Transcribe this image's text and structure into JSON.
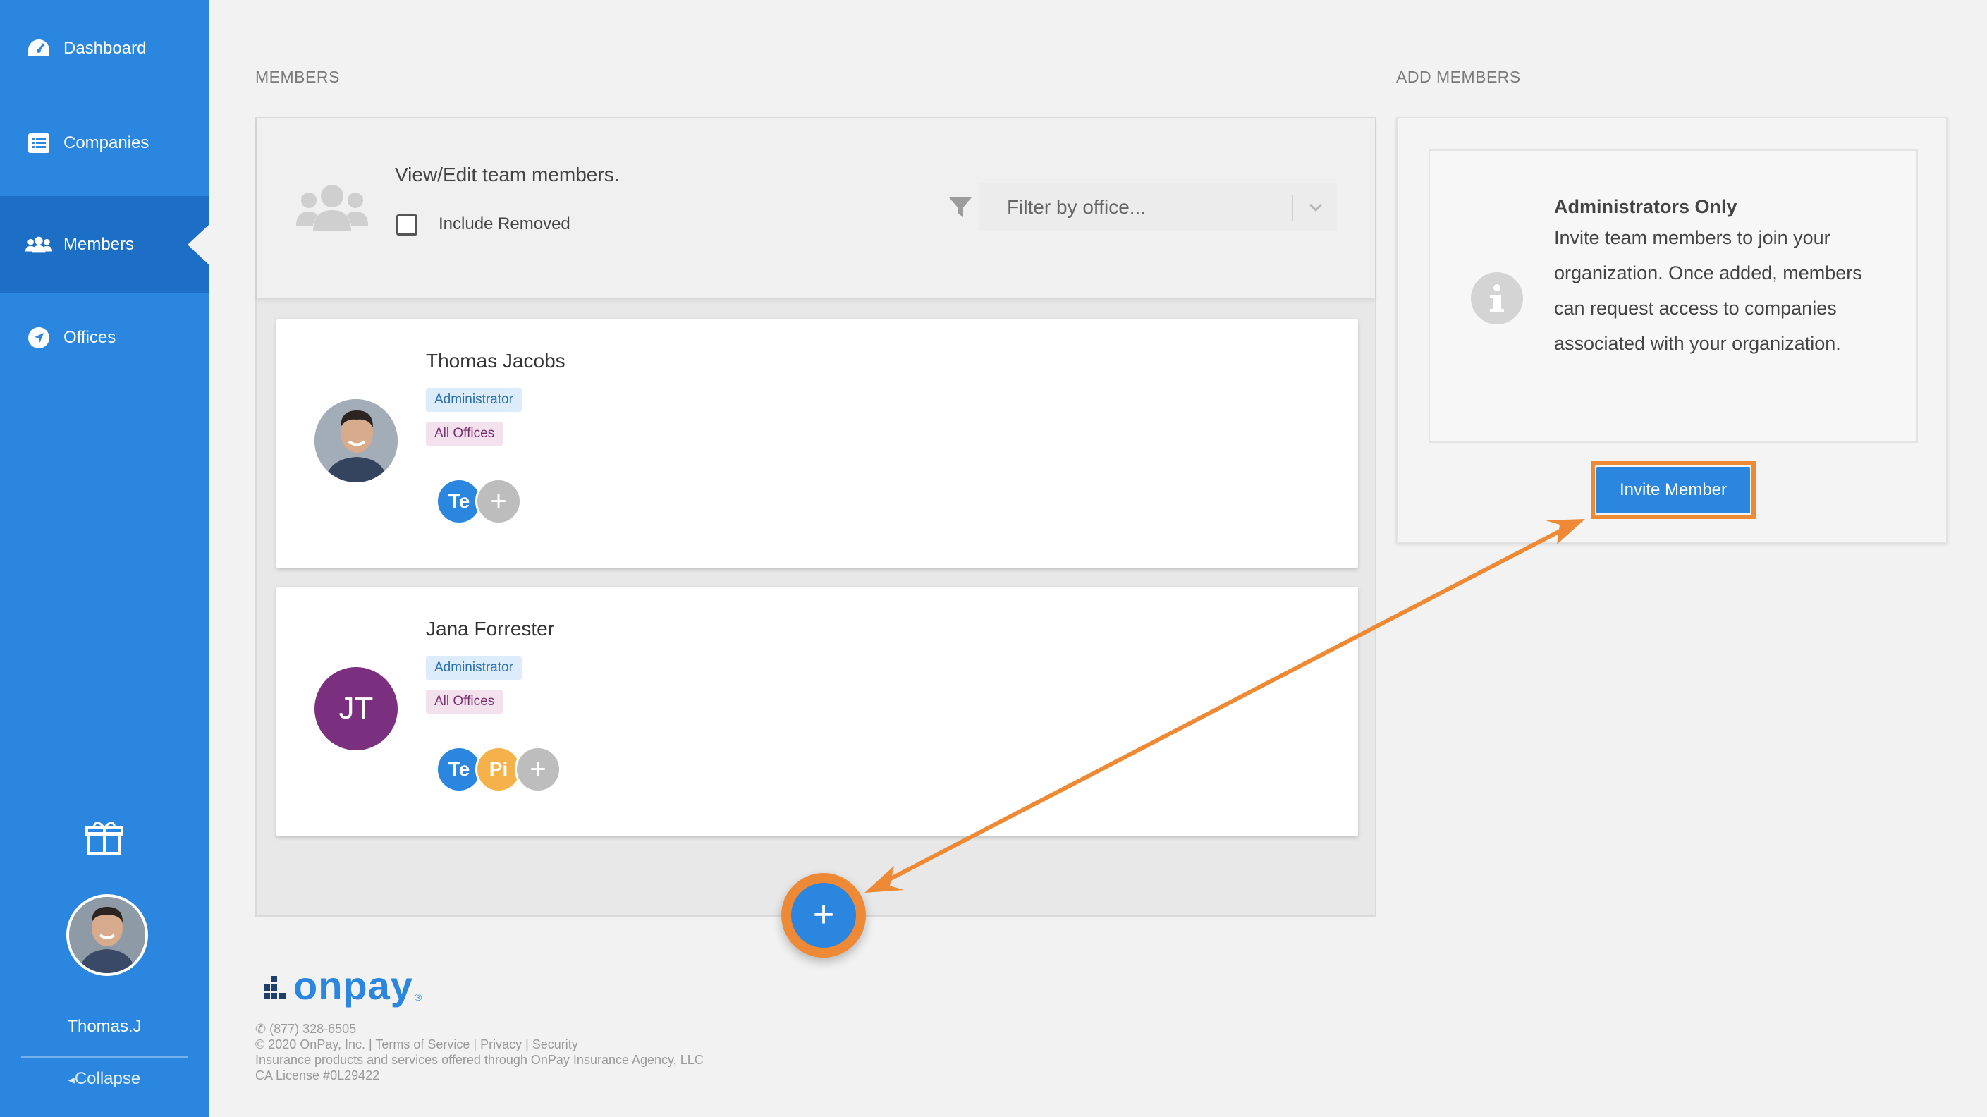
{
  "sidebar": {
    "items": [
      {
        "label": "Dashboard",
        "icon": "dashboard-icon"
      },
      {
        "label": "Companies",
        "icon": "list-icon"
      },
      {
        "label": "Members",
        "icon": "users-icon"
      },
      {
        "label": "Offices",
        "icon": "location-arrow-icon"
      }
    ],
    "active": "Members",
    "user_name": "Thomas.J",
    "collapse_label": "Collapse"
  },
  "members": {
    "heading": "MEMBERS",
    "panel_title": "View/Edit team members.",
    "include_removed_label": "Include Removed",
    "filter_placeholder": "Filter by office...",
    "list": [
      {
        "name": "Thomas Jacobs",
        "role": "Administrator",
        "offices": "All Offices",
        "avatar": "photo",
        "companies": [
          "Te"
        ]
      },
      {
        "name": "Jana Forrester",
        "role": "Administrator",
        "offices": "All Offices",
        "initials": "JT",
        "avatar_color": "#7b2f7f",
        "companies": [
          "Te",
          "Pi"
        ]
      }
    ],
    "fab_label": "+"
  },
  "add_members": {
    "heading": "ADD MEMBERS",
    "info_title": "Administrators Only",
    "info_text": "Invite team members to join your organization. Once added, members can request access to companies associated with your organization.",
    "invite_button": "Invite Member"
  },
  "footer": {
    "logo_text": "onpay",
    "logo_reg": "®",
    "phone": "(877) 328-6505",
    "copyright_line": "© 2020 OnPay, Inc. | Terms of Service | Privacy | Security",
    "insurance_line": "Insurance products and services offered through OnPay Insurance Agency, LLC",
    "license_line": "CA License #0L29422"
  },
  "colors": {
    "sidebar": "#2a86de",
    "sidebar_active": "#1c6fc5",
    "accent": "#2a86de",
    "highlight": "#ee8a35",
    "admin_badge_bg": "#dcecfa",
    "office_badge_bg": "#f3e1ee"
  }
}
